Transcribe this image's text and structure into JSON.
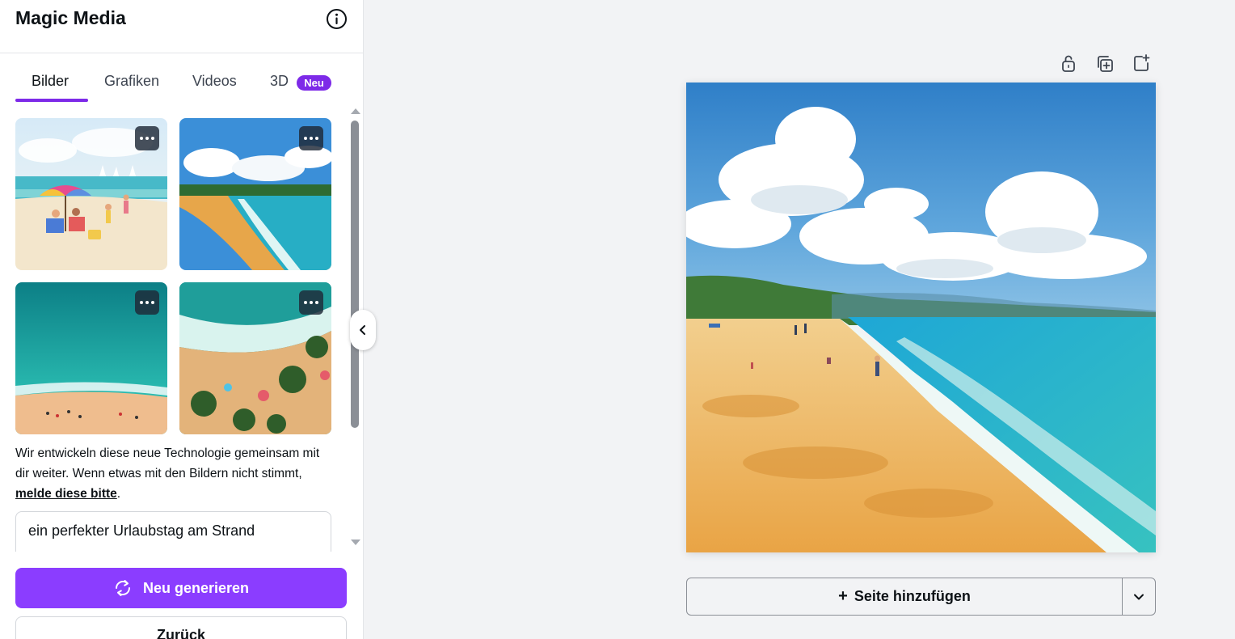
{
  "panel": {
    "title": "Magic Media",
    "tabs": [
      {
        "label": "Bilder",
        "active": true
      },
      {
        "label": "Grafiken",
        "active": false
      },
      {
        "label": "Videos",
        "active": false
      },
      {
        "label": "3D",
        "active": false,
        "badge": "Neu"
      }
    ],
    "results": [
      {
        "name": "beach-umbrella-watercolor"
      },
      {
        "name": "beach-shoreline-painting"
      },
      {
        "name": "aerial-turquoise-beach"
      },
      {
        "name": "aerial-palm-waves"
      }
    ],
    "note": {
      "text": "Wir entwickeln diese neue Technologie gemeinsam mit dir weiter. Wenn etwas mit den Bildern nicht stimmt, ",
      "link": "melde diese bitte",
      "suffix": "."
    },
    "prompt": "ein perfekter Urlaubstag am Strand",
    "generate_label": "Neu generieren",
    "back_label": "Zurück"
  },
  "canvas": {
    "add_page_label": "Seite hinzufügen",
    "add_page_plus": "+"
  },
  "colors": {
    "accent": "#8b3dff",
    "tab_underline": "#7d2ae8"
  },
  "icons": [
    "info-icon",
    "ellipsis-icon",
    "regenerate-icon",
    "chevron-left-icon",
    "unlock-icon",
    "duplicate-page-icon",
    "add-page-icon",
    "chevron-down-icon"
  ]
}
